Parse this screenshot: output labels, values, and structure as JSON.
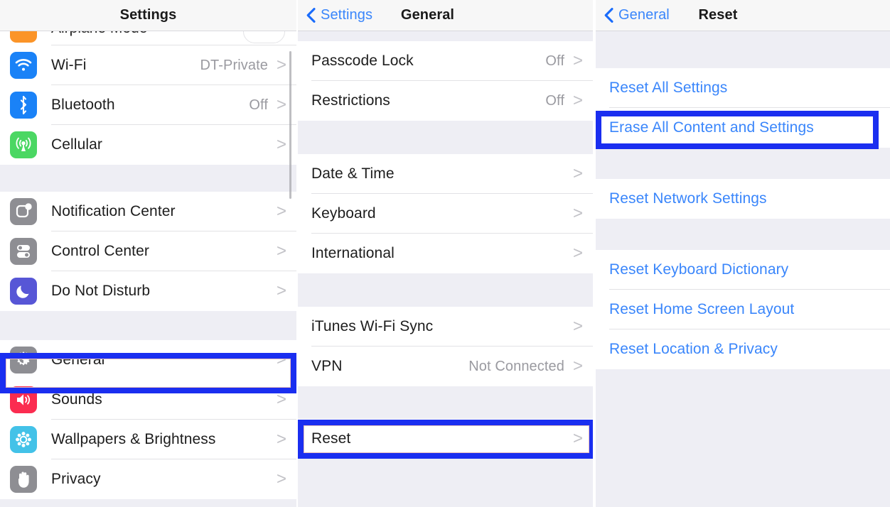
{
  "panels": {
    "settings": {
      "nav": {
        "title": "Settings"
      },
      "cut_row": {
        "label": "Airplane Mode",
        "icon": "airplane-icon"
      },
      "groups": [
        {
          "rows": [
            {
              "label": "Wi-Fi",
              "value": "DT-Private",
              "icon": "wifi-icon",
              "chevron": ">"
            },
            {
              "label": "Bluetooth",
              "value": "Off",
              "icon": "bluetooth-icon",
              "chevron": ">"
            },
            {
              "label": "Cellular",
              "value": "",
              "icon": "cellular-icon",
              "chevron": ">"
            }
          ]
        },
        {
          "rows": [
            {
              "label": "Notification Center",
              "value": "",
              "icon": "notification-center-icon",
              "chevron": ">"
            },
            {
              "label": "Control Center",
              "value": "",
              "icon": "control-center-icon",
              "chevron": ">"
            },
            {
              "label": "Do Not Disturb",
              "value": "",
              "icon": "moon-icon",
              "chevron": ">"
            }
          ]
        },
        {
          "rows": [
            {
              "label": "General",
              "value": "",
              "icon": "gear-icon",
              "chevron": ">"
            },
            {
              "label": "Sounds",
              "value": "",
              "icon": "speaker-icon",
              "chevron": ">"
            },
            {
              "label": "Wallpapers & Brightness",
              "value": "",
              "icon": "wallpaper-icon",
              "chevron": ">"
            },
            {
              "label": "Privacy",
              "value": "",
              "icon": "hand-icon",
              "chevron": ">"
            }
          ]
        }
      ]
    },
    "general": {
      "nav": {
        "back_label": "Settings",
        "title": "General",
        "back_icon": "chevron-left-icon"
      },
      "groups": [
        {
          "rows": [
            {
              "label": "Passcode Lock",
              "value": "Off",
              "chevron": ">"
            },
            {
              "label": "Restrictions",
              "value": "Off",
              "chevron": ">"
            }
          ]
        },
        {
          "rows": [
            {
              "label": "Date & Time",
              "value": "",
              "chevron": ">"
            },
            {
              "label": "Keyboard",
              "value": "",
              "chevron": ">"
            },
            {
              "label": "International",
              "value": "",
              "chevron": ">"
            }
          ]
        },
        {
          "rows": [
            {
              "label": "iTunes Wi-Fi Sync",
              "value": "",
              "chevron": ">"
            },
            {
              "label": "VPN",
              "value": "Not Connected",
              "chevron": ">"
            }
          ]
        },
        {
          "rows": [
            {
              "label": "Reset",
              "value": "",
              "chevron": ">"
            }
          ]
        }
      ]
    },
    "reset": {
      "nav": {
        "back_label": "General",
        "title": "Reset",
        "back_icon": "chevron-left-icon"
      },
      "groups": [
        {
          "rows": [
            {
              "label": "Reset All Settings"
            },
            {
              "label": "Erase All Content and Settings"
            }
          ]
        },
        {
          "rows": [
            {
              "label": "Reset Network Settings"
            }
          ]
        },
        {
          "rows": [
            {
              "label": "Reset Keyboard Dictionary"
            },
            {
              "label": "Reset Home Screen Layout"
            },
            {
              "label": "Reset Location & Privacy"
            }
          ]
        }
      ]
    }
  },
  "highlights": [
    {
      "name": "general-highlight",
      "target": "General"
    },
    {
      "name": "reset-highlight",
      "target": "Reset"
    },
    {
      "name": "erase-highlight",
      "target": "Erase All Content and Settings"
    }
  ],
  "colors": {
    "accent_blue": "#3a86fb",
    "highlight_blue": "#1a2ef0",
    "group_bg": "#eeeef4",
    "row_bg": "#ffffff",
    "nav_bg": "#f7f7f7",
    "label": "#1d1d1d",
    "value_gray": "#9a9aa0"
  }
}
